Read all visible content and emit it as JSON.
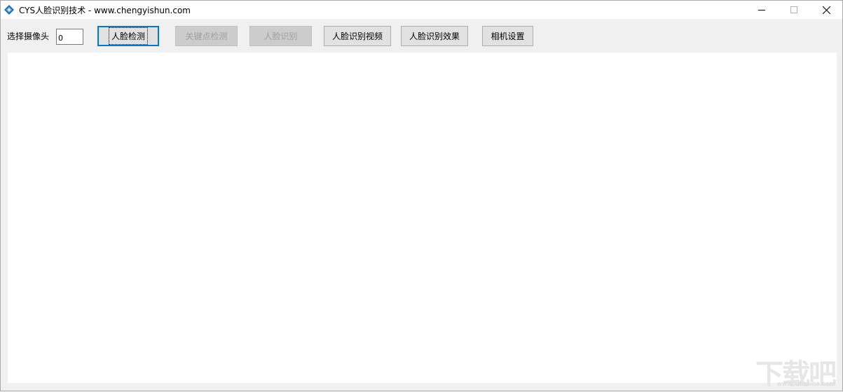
{
  "window": {
    "title": "CYS人脸识别技术  -   www.chengyishun.com",
    "icon": "app-diamond-icon",
    "controls": [
      "minimize-icon",
      "maximize-icon",
      "close-icon"
    ]
  },
  "toolbar": {
    "camera_label": "选择摄像头",
    "camera_value": "0",
    "buttons": [
      {
        "label": "人脸检测",
        "state": "default"
      },
      {
        "label": "关键点检测",
        "state": "disabled"
      },
      {
        "label": "人脸识别",
        "state": "disabled"
      },
      {
        "label": "人脸识别视频",
        "state": "enabled"
      },
      {
        "label": "人脸识别效果",
        "state": "enabled"
      },
      {
        "label": "相机设置",
        "state": "enabled"
      }
    ]
  },
  "watermark": {
    "text": "下载吧",
    "url": "www.xiazaiba.com"
  },
  "colors": {
    "accent": "#0078d7",
    "button_bg": "#e1e1e1",
    "window_bg": "#f0f0f0",
    "icon_blue": "#1f6fb5"
  }
}
